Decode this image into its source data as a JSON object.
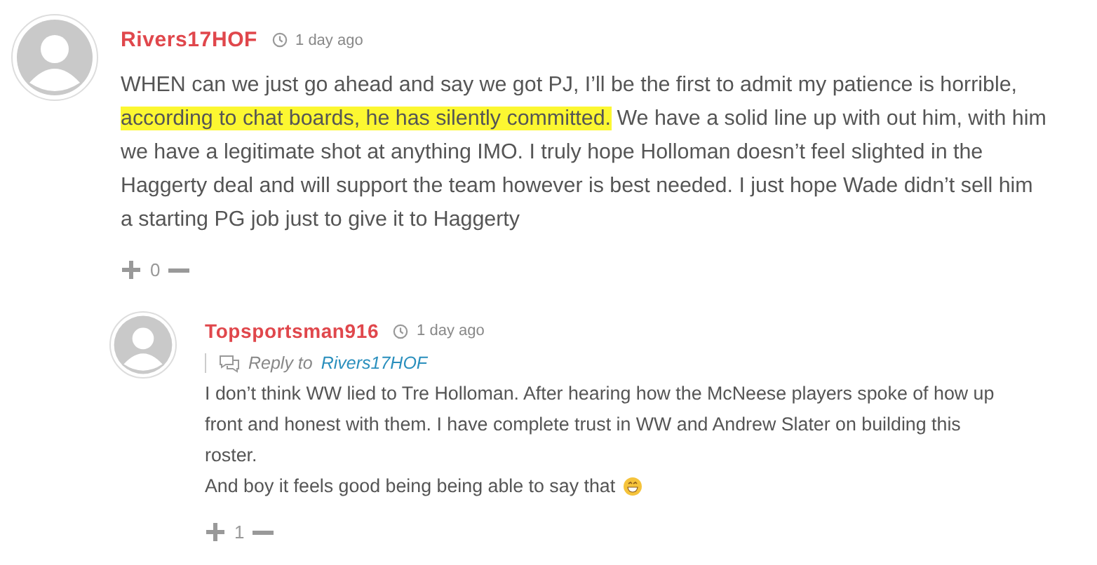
{
  "comments": [
    {
      "author": "Rivers17HOF",
      "time": "1 day ago",
      "paragraphs": [
        {
          "segments": [
            {
              "text": "WHEN can we just go ahead and say we got PJ, I’ll be the first to admit my patience is horrible, ",
              "highlighted": false
            },
            {
              "text": "according to chat boards, he has silently committed.",
              "highlighted": true
            },
            {
              "text": " We have a solid line up with out him, with him we have a legitimate shot at anything IMO. I truly hope Holloman doesn’t feel slighted in the Haggerty deal and will support the team however is best needed. I just hope Wade didn’t sell him a starting PG job just to give it to Haggerty",
              "highlighted": false
            }
          ]
        }
      ],
      "votes": "0",
      "children": [
        {
          "author": "Topsportsman916",
          "time": "1 day ago",
          "reply_label": "Reply to",
          "reply_to": "Rivers17HOF",
          "paragraphs": [
            {
              "segments": [
                {
                  "text": "I don’t think WW lied to Tre Holloman. After hearing how the McNeese players spoke of how up front and honest with them. I have complete trust in WW and Andrew Slater on building this roster.",
                  "highlighted": false
                }
              ]
            },
            {
              "segments": [
                {
                  "text": "And boy it feels good being being able to say that",
                  "highlighted": false
                }
              ],
              "emoji": true
            }
          ],
          "votes": "1"
        }
      ]
    }
  ]
}
